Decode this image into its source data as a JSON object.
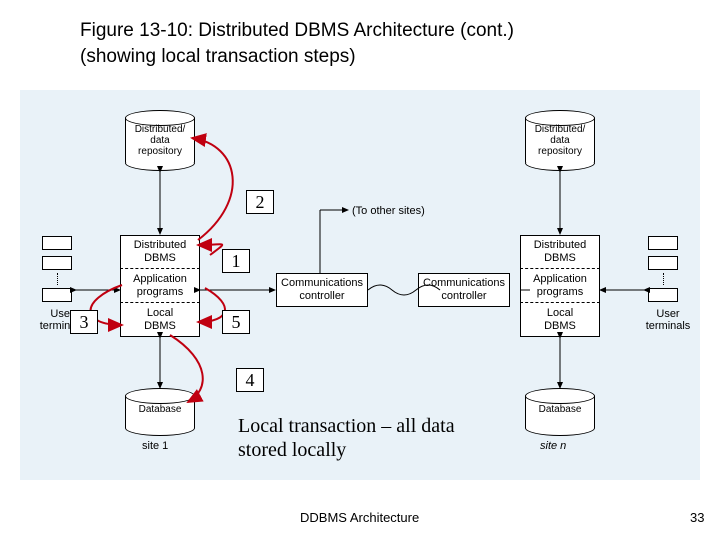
{
  "title_line1": "Figure 13-10:  Distributed DBMS Architecture (cont.)",
  "title_line2": "(showing local transaction steps)",
  "repo_left": "Distributed/\ndata\nrepository",
  "repo_right": "Distributed/\ndata\nrepository",
  "left_stack": {
    "dist_dbms": "Distributed\nDBMS",
    "app": "Application\nprograms",
    "local_dbms": "Local\nDBMS"
  },
  "right_stack": {
    "dist_dbms": "Distributed\nDBMS",
    "app": "Application\nprograms",
    "local_dbms": "Local\nDBMS"
  },
  "comm_left": "Communications\ncontroller",
  "comm_right": "Communications\ncontroller",
  "to_other_sites": "(To other sites)",
  "user_terminals_left": "User\nterminals",
  "user_terminals_right": "User\nterminals",
  "db_left": "Database",
  "db_right": "Database",
  "site_left": "site 1",
  "site_right": "site n",
  "steps": {
    "s1": "1",
    "s2": "2",
    "s3": "3",
    "s4": "4",
    "s5": "5"
  },
  "description": "Local transaction – all data stored locally",
  "footer_center": "DDBMS Architecture",
  "footer_page": "33"
}
